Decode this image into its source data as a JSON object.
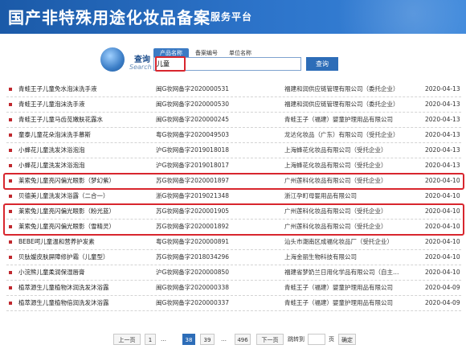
{
  "header": {
    "title": "国产非特殊用途化妆品备案",
    "subtitle": "服务平台"
  },
  "search": {
    "logo_zh": "查询",
    "logo_en": "Search",
    "tabs": [
      {
        "label": "产品名称",
        "active": true
      },
      {
        "label": "备案编号",
        "active": false
      },
      {
        "label": "单位名称",
        "active": false
      }
    ],
    "value": "儿童",
    "button_label": "查询"
  },
  "results": [
    {
      "name": "青蛙王子儿童免水泡沫洗手液",
      "code": "闽G妆网备字2020000531",
      "company": "福建和润供应链管理有限公司（委托企业）",
      "date": "2020-04-13",
      "highlight": false
    },
    {
      "name": "青蛙王子儿童泡沫洗手液",
      "code": "闽G妆网备字2020000530",
      "company": "福建和润供应链管理有限公司（委托企业）",
      "date": "2020-04-13",
      "highlight": false
    },
    {
      "name": "青蛙王子儿童马齿苋嫩肤花露水",
      "code": "闽G妆网备字2020000245",
      "company": "青蛙王子（福建）婴童护理用品有限公司",
      "date": "2020-04-13",
      "highlight": false
    },
    {
      "name": "童泰儿童花朵泡沫洗手慕斯",
      "code": "粤G妆网备字2020049503",
      "company": "龙达化妆品（广东）有限公司（受托企业）",
      "date": "2020-04-13",
      "highlight": false
    },
    {
      "name": "小蜂花儿童洗发沐浴泡泡",
      "code": "沪G妆网备字2019018018",
      "company": "上海蜂花化妆品有限公司（受托企业）",
      "date": "2020-04-13",
      "highlight": false
    },
    {
      "name": "小蜂花儿童洗发沐浴泡泡",
      "code": "沪G妆网备字2019018017",
      "company": "上海蜂花化妆品有限公司（受托企业）",
      "date": "2020-04-13",
      "highlight": false
    },
    {
      "name": "莱索兔儿童亮闪偏光眼影（梦幻紫）",
      "code": "苏G妆网备字2020001897",
      "company": "广州莲科化妆品有限公司（受托企业）",
      "date": "2020-04-10",
      "highlight": true
    },
    {
      "name": "贝德美儿童洗发沐浴露（二合一）",
      "code": "浙G妆网备字2019021348",
      "company": "浙江孕町母婴用品有限公司",
      "date": "2020-04-10",
      "highlight": false
    },
    {
      "name": "莱索兔儿童亮闪偏光眼影（粉光蓝）",
      "code": "苏G妆网备字2020001905",
      "company": "广州莲科化妆品有限公司（受托企业）",
      "date": "2020-04-10",
      "highlight": true
    },
    {
      "name": "莱索兔儿童亮闪偏光眼影（雪精灵）",
      "code": "苏G妆网备字2020001892",
      "company": "广州莲科化妆品有限公司（受托企业）",
      "date": "2020-04-10",
      "highlight": true
    },
    {
      "name": "BEBE呵儿童温和营养护发素",
      "code": "粤G妆网备字2020000891",
      "company": "汕头市潮南区成福化妆品厂（受托企业）",
      "date": "2020-04-10",
      "highlight": false
    },
    {
      "name": "贝肽嫒皮肤屏障修护霜（儿童型）",
      "code": "苏G妆网备字2018034296",
      "company": "上海金丽生物科技有限公司",
      "date": "2020-04-10",
      "highlight": false
    },
    {
      "name": "小浣熊儿童柔润保湿唇膏",
      "code": "沪G妆网备字2020000850",
      "company": "福建省梦奶兰日用化学品有限公司（自主…",
      "date": "2020-04-10",
      "highlight": false
    },
    {
      "name": "植萃源生儿童植物沐润洗发沐浴露",
      "code": "闽G妆网备字2020000338",
      "company": "青蛙王子（福建）婴童护理用品有限公司",
      "date": "2020-04-09",
      "highlight": false
    },
    {
      "name": "植萃源生儿童植物倍润洗发沐浴露",
      "code": "闽G妆网备字2020000337",
      "company": "青蛙王子（福建）婴童护理用品有限公司",
      "date": "2020-04-09",
      "highlight": false
    }
  ],
  "pager": {
    "prev": "上一页",
    "first": "1",
    "dots1": "…",
    "current": "38",
    "next_num": "39",
    "dots2": "…",
    "last": "496",
    "next": "下一页",
    "jump_label": "跳转到",
    "page_unit": "页",
    "confirm": "确定"
  }
}
